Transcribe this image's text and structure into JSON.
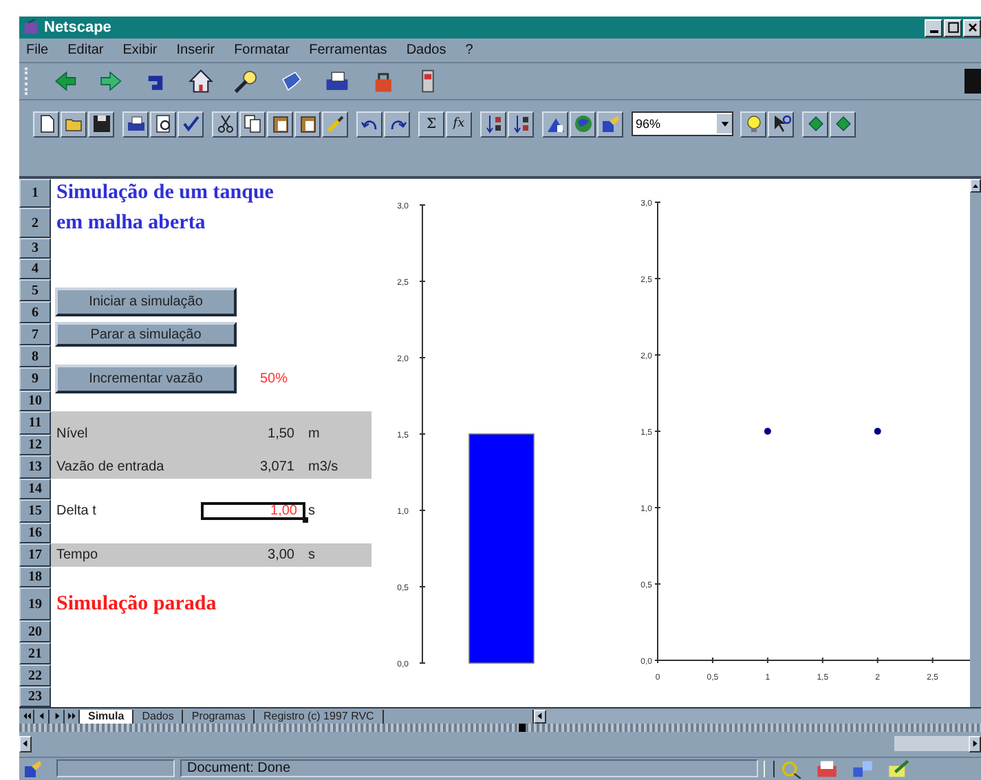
{
  "window": {
    "title": "Netscape"
  },
  "menu": [
    "File",
    "Editar",
    "Exibir",
    "Inserir",
    "Formatar",
    "Ferramentas",
    "Dados",
    "?"
  ],
  "excel_toolbar": {
    "sum_glyph": "Σ",
    "function_glyph": "fx",
    "zoom_value": "96%"
  },
  "row_headers": [
    "1",
    "2",
    "3",
    "4",
    "5",
    "6",
    "7",
    "8",
    "9",
    "10",
    "11",
    "12",
    "13",
    "14",
    "15",
    "16",
    "17",
    "18",
    "19",
    "20",
    "21",
    "22",
    "23"
  ],
  "sheet": {
    "title_lines": [
      "Simulação de um tanque",
      "em malha aberta"
    ],
    "buttons": [
      "Iniciar a simulação",
      "Parar a simulação",
      "Incrementar vazão"
    ],
    "flow_increment": "50%",
    "readouts": [
      {
        "label": "Nível",
        "value": "1,50",
        "unit": "m",
        "kind": "shaded"
      },
      {
        "label": "Vazão de entrada",
        "value": "3,071",
        "unit": "m3/s",
        "kind": "shaded"
      },
      {
        "label": "Delta t",
        "value": "1,00",
        "unit": "s",
        "kind": "input"
      },
      {
        "label": "Tempo",
        "value": "3,00",
        "unit": "s",
        "kind": "shaded"
      }
    ],
    "status_message": "Simulação parada"
  },
  "charts": [
    {
      "chart_data": {
        "type": "bar",
        "categories": [
          null
        ],
        "ylim": [
          0,
          3
        ],
        "yticks": [
          {
            "value": 0,
            "label": "0,0"
          },
          {
            "value": 0.5,
            "label": "0,5"
          },
          {
            "value": 1,
            "label": "1,0"
          },
          {
            "value": 1.5,
            "label": "1,5"
          },
          {
            "value": 2,
            "label": "2,0"
          },
          {
            "value": 2.5,
            "label": "2,5"
          },
          {
            "value": 3,
            "label": "3,0"
          }
        ],
        "series": [
          {
            "color": "#0000ff",
            "values": [
              1.5
            ]
          }
        ]
      }
    },
    {
      "chart_data": {
        "type": "scatter",
        "x": [
          1,
          2
        ],
        "xlim": [
          0,
          2.84
        ],
        "ylim": [
          0,
          3
        ],
        "xticks": [
          {
            "value": 0,
            "label": "0"
          },
          {
            "value": 0.5,
            "label": "0,5"
          },
          {
            "value": 1,
            "label": "1"
          },
          {
            "value": 1.5,
            "label": "1,5"
          },
          {
            "value": 2,
            "label": "2"
          },
          {
            "value": 2.5,
            "label": "2,5"
          }
        ],
        "yticks": [
          {
            "value": 0,
            "label": "0,0"
          },
          {
            "value": 0.5,
            "label": "0,5"
          },
          {
            "value": 1,
            "label": "1,0"
          },
          {
            "value": 1.5,
            "label": "1,5"
          },
          {
            "value": 2,
            "label": "2,0"
          },
          {
            "value": 2.5,
            "label": "2,5"
          },
          {
            "value": 3,
            "label": "3,0"
          }
        ],
        "series": [
          {
            "color": "#000080",
            "values": [
              1.5,
              1.5
            ]
          }
        ]
      }
    }
  ],
  "sheet_tabs": [
    {
      "label": "Simula",
      "selected": true
    },
    {
      "label": "Dados",
      "selected": false
    },
    {
      "label": "Programas",
      "selected": false
    },
    {
      "label": "Registro (c) 1997 RVC",
      "selected": false
    }
  ],
  "status_bar": {
    "text": "Document: Done"
  }
}
